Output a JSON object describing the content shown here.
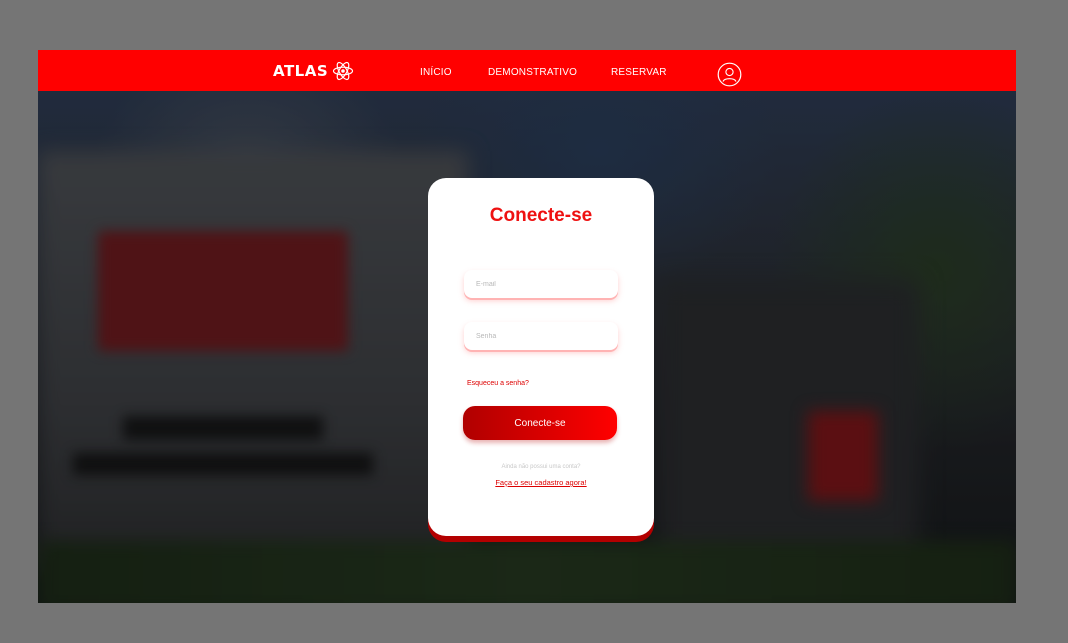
{
  "header": {
    "logo_text": "ATLAS",
    "logo_icon": "atom-icon",
    "nav": {
      "inicio": "INÍCIO",
      "demonstrativo": "DEMONSTRATIVO",
      "reservar": "RESERVAR"
    },
    "user_icon": "user-profile-icon",
    "background_color": "#ff0000"
  },
  "login": {
    "title": "Conecte-se",
    "email_placeholder": "E-mail",
    "password_placeholder": "Senha",
    "forgot_password": "Esqueceu a senha?",
    "submit_label": "Conecte-se",
    "no_account_text": "Ainda não possui uma conta?",
    "signup_link": "Faça o seu cadastro agora!"
  },
  "colors": {
    "accent": "#ff0000",
    "accent_dark": "#b00000",
    "outer_background": "#757575"
  }
}
